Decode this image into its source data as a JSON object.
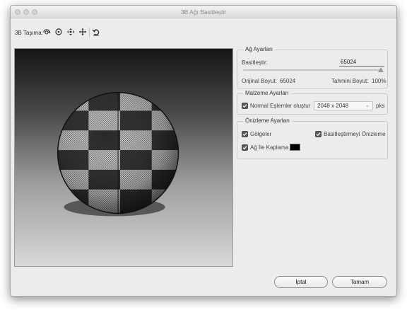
{
  "window": {
    "title": "3B Ağı Basitleştir"
  },
  "toolbar": {
    "label": "3B Taşıma:",
    "buttons": [
      "orbit-3d-icon",
      "roll-3d-icon",
      "pan-3d-icon",
      "move-3d-icon",
      "reset-view-icon"
    ]
  },
  "mesh_settings": {
    "title": "Ağ Ayarları",
    "simplify_label": "Basitleştir:",
    "simplify_value": "65024",
    "original_size_label": "Orijinal Boyut:",
    "original_size_value": "65024",
    "estimated_size_label": "Tahmini Boyut:",
    "estimated_size_value": "100%"
  },
  "material_settings": {
    "title": "Malzeme Ayarları",
    "normal_maps_label": "Normal Eşlemler oluştur",
    "normal_maps_checked": true,
    "resolution_value": "2048 x 2048",
    "resolution_unit": "pks"
  },
  "preview_settings": {
    "title": "Önizleme Ayarları",
    "shadows_label": "Gölgeler",
    "shadows_checked": true,
    "preview_simplify_label": "Basitleştirmeyi Önizleme",
    "preview_simplify_checked": true,
    "mesh_overlay_label": "Ağ İle Kaplama",
    "mesh_overlay_checked": true,
    "overlay_color": "#000000"
  },
  "buttons": {
    "cancel_label": "İptal",
    "ok_label": "Tamam"
  }
}
